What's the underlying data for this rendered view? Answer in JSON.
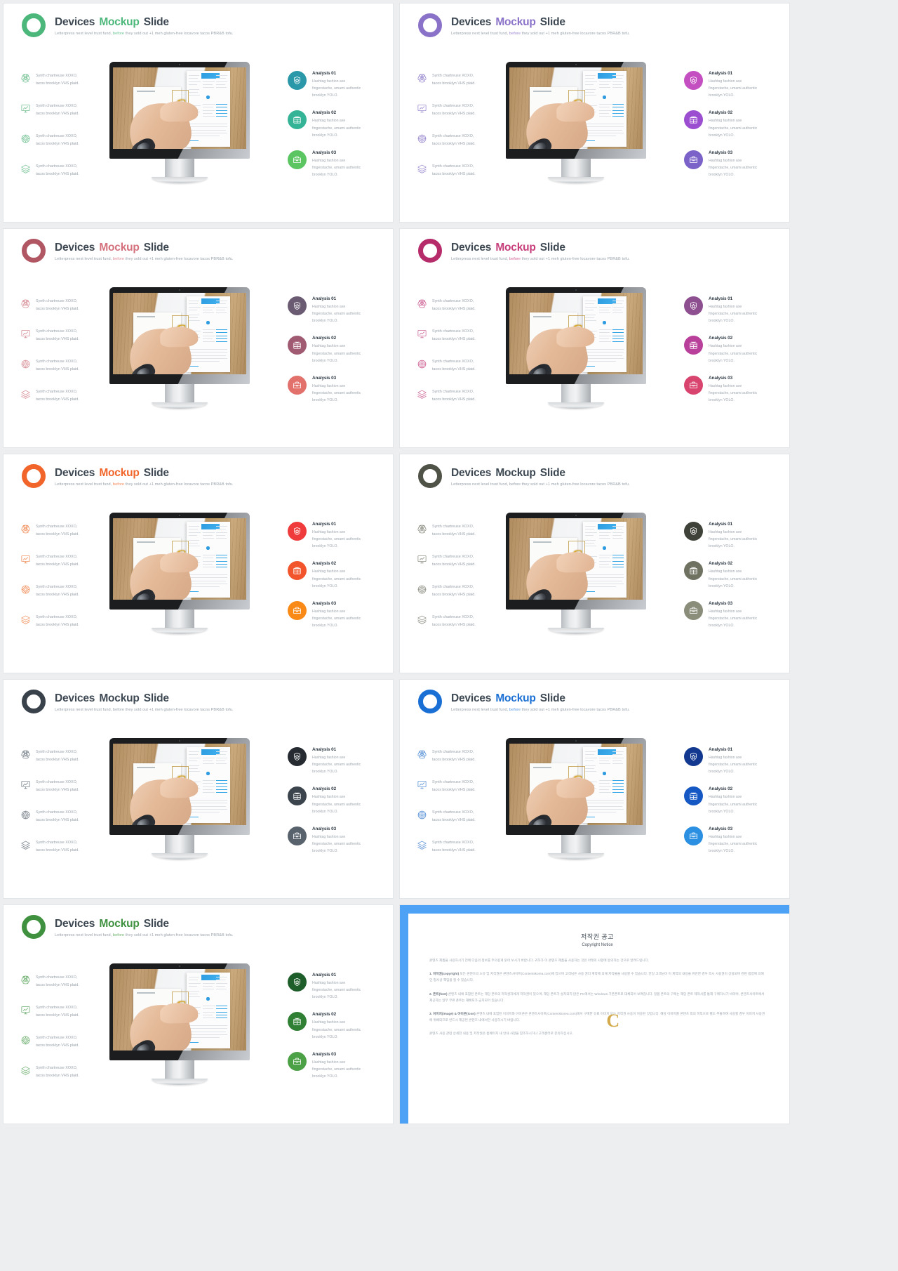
{
  "deck": {
    "common": {
      "title_part1": "Devices",
      "title_accent": "Mockup",
      "title_part3": "Slide",
      "subtitle_pre": "Letterpress next level trust fund,",
      "subtitle_accent": "before",
      "subtitle_post": "they sold out +1 meh gluten-free locavore tacos PBR&B tofu.",
      "feature_line1": "Synth chartreuse XOXO,",
      "feature_line2": "tacos brooklyn VHS plaid.",
      "analysis_desc_line1": "Hashtag fashion axe",
      "analysis_desc_line2": "fingerstache, umami authentic",
      "analysis_desc_line3": "brooklyn YOLO.",
      "analysis_titles": [
        "Analysis 01",
        "Analysis 02",
        "Analysis 03"
      ],
      "feature_icons": [
        "atom-icon",
        "presentation-chart-icon",
        "target-icon",
        "layers-icon"
      ],
      "analysis_icons": [
        "shield-star-icon",
        "gift-calendar-icon",
        "briefcase-icon"
      ]
    },
    "slides": [
      {
        "theme": "green",
        "ring_color": "#4cb77a",
        "title_accent_color": "#4cb77a",
        "subtitle_accent_color": "#69c48e",
        "feature_icon_color": "#73c193",
        "badge_colors": [
          "#2a98a8",
          "#35b396",
          "#5bc562"
        ]
      },
      {
        "theme": "purple",
        "ring_color": "#8a72c8",
        "title_accent_color": "#8a72c8",
        "subtitle_accent_color": "#9b86d2",
        "feature_icon_color": "#9b8bd0",
        "badge_colors": [
          "#c44fc0",
          "#9b4fd0",
          "#7b62c8"
        ]
      },
      {
        "theme": "rose",
        "ring_color": "#b05763",
        "title_accent_color": "#d4707c",
        "subtitle_accent_color": "#dd8a94",
        "feature_icon_color": "#d88f97",
        "badge_colors": [
          "#6a5a72",
          "#a05a72",
          "#e2706b"
        ]
      },
      {
        "theme": "magenta",
        "ring_color": "#b62b6a",
        "title_accent_color": "#c73d7a",
        "subtitle_accent_color": "#d45f93",
        "feature_icon_color": "#cf6a9a",
        "badge_colors": [
          "#8d4f8f",
          "#b8409a",
          "#d8446d"
        ]
      },
      {
        "theme": "orange",
        "ring_color": "#f1652a",
        "title_accent_color": "#f1652a",
        "subtitle_accent_color": "#f58a5c",
        "feature_icon_color": "#f1915f",
        "badge_colors": [
          "#ef3b3b",
          "#f2552c",
          "#f98a18"
        ]
      },
      {
        "theme": "olive",
        "ring_color": "#4f5246",
        "title_accent_color": "#3d4852",
        "subtitle_accent_color": "#9aa3ac",
        "feature_icon_color": "#8d9084",
        "badge_colors": [
          "#3f4238",
          "#6f7260",
          "#8a8d7a"
        ]
      },
      {
        "theme": "charcoal",
        "ring_color": "#39414a",
        "title_accent_color": "#3d4852",
        "subtitle_accent_color": "#9aa3ac",
        "feature_icon_color": "#78808a",
        "badge_colors": [
          "#252b31",
          "#3b434c",
          "#58626c"
        ]
      },
      {
        "theme": "blue",
        "ring_color": "#1a6fd4",
        "title_accent_color": "#1a6fd4",
        "subtitle_accent_color": "#5b9ae8",
        "feature_icon_color": "#5e94d8",
        "badge_colors": [
          "#12398f",
          "#1558c4",
          "#2b8fe2"
        ]
      },
      {
        "theme": "darkgreen",
        "ring_color": "#3f9140",
        "title_accent_color": "#3f9140",
        "subtitle_accent_color": "#6cb06a",
        "feature_icon_color": "#72b274",
        "badge_colors": [
          "#1e5e2a",
          "#2f7f34",
          "#4ca147"
        ]
      }
    ]
  },
  "copyright": {
    "title_ko": "저작권 공고",
    "title_en": "Copyright Notice",
    "intro": "콘텐츠 제품을 사용하시기 전에 다음의 정보를 주의깊게 읽어 보시기 바랍니다. 귀하가 이 콘텐츠 제품을 사용하는 것은 아래의 사항에 동의하는 것으로 알려드립니다.",
    "clause1_head": "1. 저작권(copyright)",
    "clause1_body": "모든 콘텐츠의 소유 및 저작권은 콘텐츠사이트(Contentskorea.com)에 있으며 고객님은 사용 권리 계약에 의해 저작물을 사용할 수 있습니다. 만일 고객님이 이 계약의 내용을 위반한 경우 즉시 사용권이 상실되며 관련 법령에 의해 민·형사상 책임을 질 수 있습니다.",
    "clause2_head": "2. 폰트(font)",
    "clause2_body": "콘텐츠 내에 포함된 폰트는 해당 폰트의 저작권자에게 저작권이 있으며, 해당 폰트가 설치되지 않은 PC에서는 Windows 기본폰트로 대체되어 보여집니다. 정품 폰트의 구매는 해당 폰트 제작사를 통해 구매하시기 바라며, 콘텐츠사이트에서 제공하는 일부 무료 폰트는 재배포가 금지되어 있습니다.",
    "clause3_head": "3. 이미지(image) & 아이콘(icon)",
    "clause3_body": "콘텐츠 내에 포함된 이미지와 아이콘은 콘텐츠사이트(Contentskorea.com)에서 구매한 유료 이미지 또는 저작권 사용이 허용된 것입니다. 해당 이미지를 콘텐츠 외의 목적으로 별도 추출하여 사용할 경우 이미지 사용권에 위배되므로 반드시 제공된 콘텐츠 내에서만 사용하시기 바랍니다.",
    "footer": "콘텐츠 사용 관련 상세한 내용 및 저작권은 홈페이지 내 안내 사항을 참조하시거나 고객센터로 문의하십시오."
  }
}
